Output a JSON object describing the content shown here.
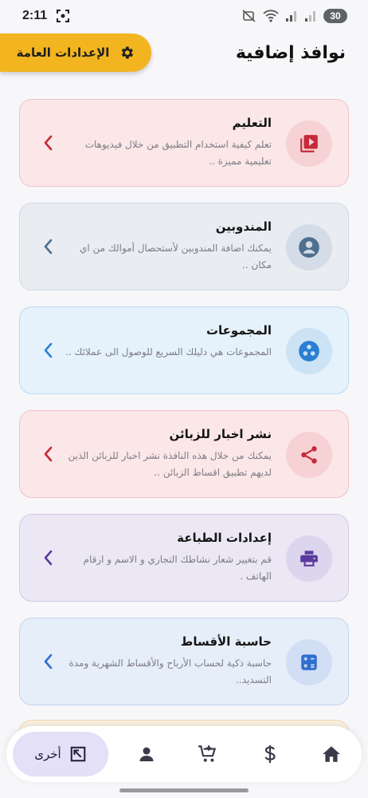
{
  "status_bar": {
    "time": "2:11",
    "battery": "30"
  },
  "header": {
    "title": "نوافذ إضافية",
    "settings_label": "الإعدادات العامة"
  },
  "cards": [
    {
      "title": "التعليم",
      "description": "تعلم كيفية استخدام التطبيق من خلال فيديوهات تعليمية مميزة ..",
      "icon": "video-library-icon",
      "bg": "#fbe7e8",
      "border": "#f0c3c6",
      "icon_bg": "#f7d2d4",
      "accent": "#c62a3a"
    },
    {
      "title": "المندوبين",
      "description": "يمكنك اضافة المندوبين لأستحصال أموالك من اي مكان ..",
      "icon": "person-icon",
      "bg": "#e9edf2",
      "border": "#cfd8e3",
      "icon_bg": "#d3dce7",
      "accent": "#4f6f8f"
    },
    {
      "title": "المجموعات",
      "description": "المجموعات هي دليلك السريع للوصول الى عملائك ..",
      "icon": "groups-icon",
      "bg": "#e5f1fb",
      "border": "#bfdcf3",
      "icon_bg": "#cce3f6",
      "accent": "#2b7fd4"
    },
    {
      "title": "نشر اخبار للزبائن",
      "description": "يمكنك من خلال هذه النافذة نشر اخبار للزبائن الذين لديهم تطبيق اقساط الزبائن ..",
      "icon": "share-icon",
      "bg": "#fbe7e8",
      "border": "#f0c3c6",
      "icon_bg": "#f7d2d4",
      "accent": "#c62a3a"
    },
    {
      "title": "إعدادات الطباعة",
      "description": "قم بتغيير شعار نشاطك التجاري و الاسم و ارقام الهاتف .",
      "icon": "printer-icon",
      "bg": "#ebe7f4",
      "border": "#d3cbe7",
      "icon_bg": "#dcd5ee",
      "accent": "#5b3a9e"
    },
    {
      "title": "حاسبة الأقساط",
      "description": "حاسبة ذكية لحساب الأرباح والأقساط الشهرية ومدة التسديد..",
      "icon": "calculator-icon",
      "bg": "#e6eef9",
      "border": "#c3d5ef",
      "icon_bg": "#d1def4",
      "accent": "#2f6fcf"
    }
  ],
  "bottom_nav": {
    "active_label": "أخرى",
    "items": [
      "home-icon",
      "dollar-icon",
      "add-cart-icon",
      "person-icon",
      "other-icon"
    ]
  }
}
